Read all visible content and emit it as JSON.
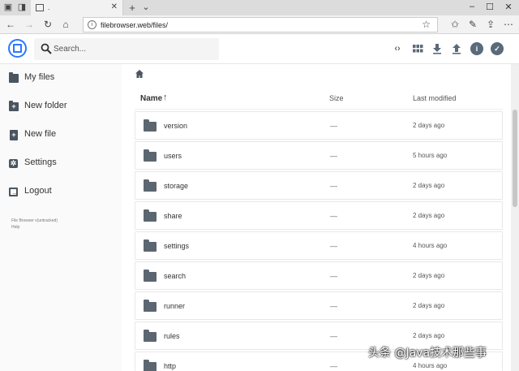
{
  "browser": {
    "tab_title": ".",
    "url": "filebrowser.web/files/",
    "new_tab": "+",
    "tab_menu": "⌄"
  },
  "app": {
    "search_placeholder": "Search..."
  },
  "sidebar": {
    "items": [
      {
        "label": "My files",
        "icon": "folder-icon"
      },
      {
        "label": "New folder",
        "icon": "folder-plus-icon"
      },
      {
        "label": "New file",
        "icon": "file-plus-icon"
      },
      {
        "label": "Settings",
        "icon": "gear-icon"
      },
      {
        "label": "Logout",
        "icon": "logout-icon"
      }
    ],
    "footer_version": "File Browser v(untracked)",
    "footer_help": "Help"
  },
  "listing": {
    "columns": {
      "name": "Name",
      "size": "Size",
      "modified": "Last modified"
    },
    "rows": [
      {
        "name": "version",
        "size": "—",
        "modified": "2 days ago"
      },
      {
        "name": "users",
        "size": "—",
        "modified": "5 hours ago"
      },
      {
        "name": "storage",
        "size": "—",
        "modified": "2 days ago"
      },
      {
        "name": "share",
        "size": "—",
        "modified": "2 days ago"
      },
      {
        "name": "settings",
        "size": "—",
        "modified": "4 hours ago"
      },
      {
        "name": "search",
        "size": "—",
        "modified": "2 days ago"
      },
      {
        "name": "runner",
        "size": "—",
        "modified": "2 days ago"
      },
      {
        "name": "rules",
        "size": "—",
        "modified": "2 days ago"
      },
      {
        "name": "http",
        "size": "—",
        "modified": "4 hours ago"
      }
    ]
  },
  "colors": {
    "accent": "#2979ff",
    "icon": "#5b6670"
  },
  "watermark": "头条 @Java技术那些事"
}
